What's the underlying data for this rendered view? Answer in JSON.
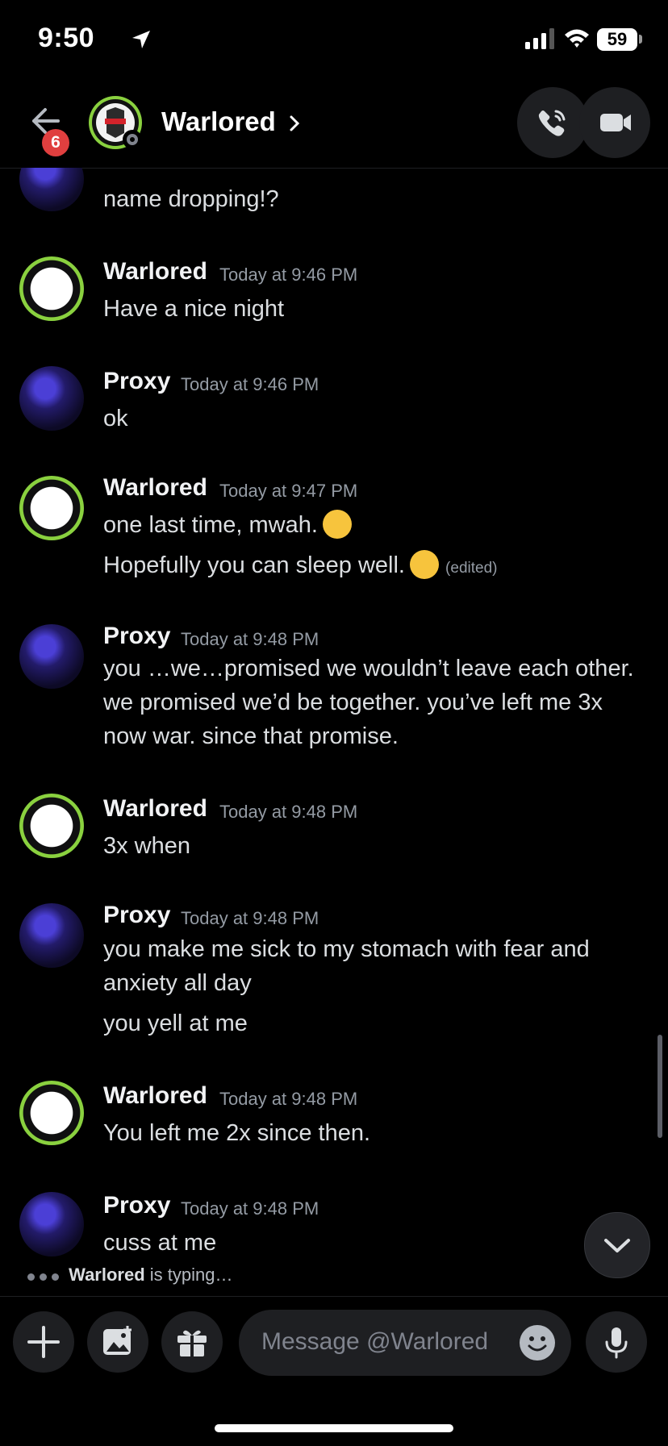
{
  "status_bar": {
    "time": "9:50",
    "battery": "59"
  },
  "header": {
    "back_badge": "6",
    "title": "Warlored"
  },
  "messages": [
    {
      "author": "",
      "timestamp": "",
      "lines": [
        "name dropping!?"
      ]
    },
    {
      "author": "Warlored",
      "timestamp": "Today at 9:46 PM",
      "lines": [
        "Have a nice night"
      ]
    },
    {
      "author": "Proxy",
      "timestamp": "Today at 9:46 PM",
      "lines": [
        "ok"
      ]
    },
    {
      "author": "Warlored",
      "timestamp": "Today at 9:47 PM",
      "lines": [
        "one last time, mwah.",
        "Hopefully you can sleep well."
      ],
      "edited": "(edited)"
    },
    {
      "author": "Proxy",
      "timestamp": "Today at 9:48 PM",
      "lines": [
        "you …we…promised we wouldn’t leave each other. we promised we’d be together. you’ve left me 3x now war. since that promise."
      ]
    },
    {
      "author": "Warlored",
      "timestamp": "Today at 9:48 PM",
      "lines": [
        "3x when"
      ]
    },
    {
      "author": "Proxy",
      "timestamp": "Today at 9:48 PM",
      "lines": [
        "you make me sick to my stomach with fear and anxiety all day",
        "you yell at me"
      ]
    },
    {
      "author": "Warlored",
      "timestamp": "Today at 9:48 PM",
      "lines": [
        "You left me 2x since then."
      ]
    },
    {
      "author": "Proxy",
      "timestamp": "Today at 9:48 PM",
      "lines": [
        "cuss at me"
      ]
    }
  ],
  "typing": {
    "user": "Warlored",
    "suffix": " is typing…"
  },
  "composer": {
    "placeholder": "Message @Warlored"
  },
  "colors": {
    "background": "#000000",
    "accent_online": "#8ad13f",
    "badge": "#e03f3f"
  }
}
